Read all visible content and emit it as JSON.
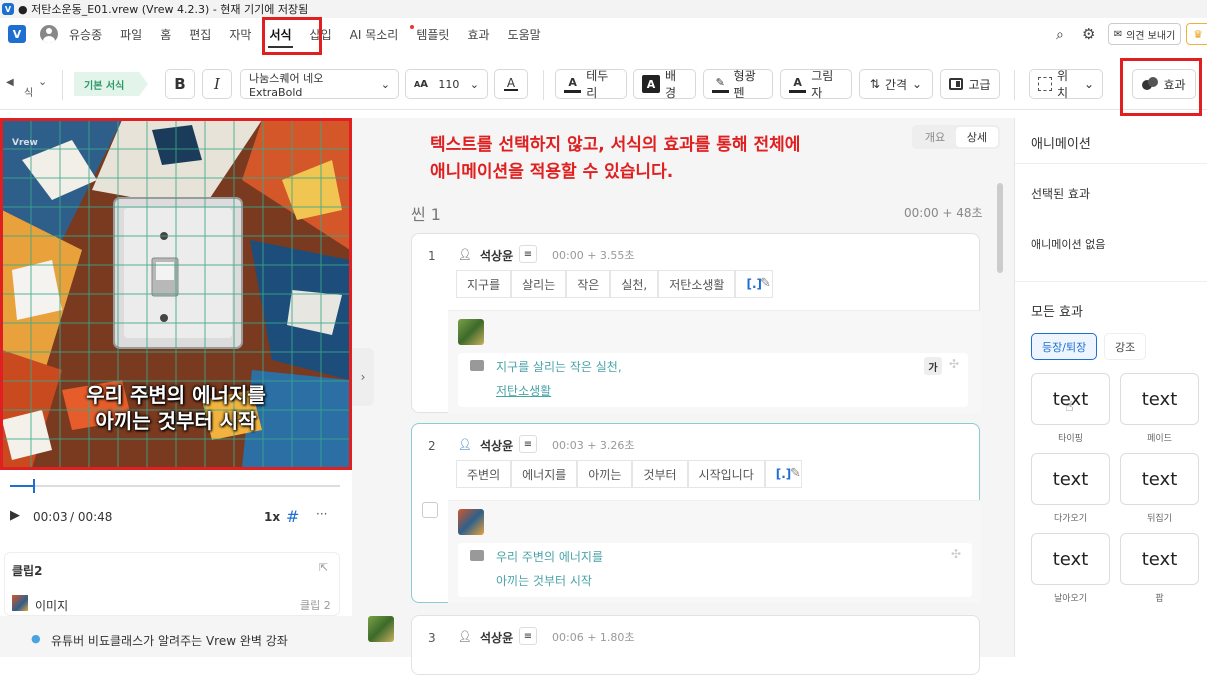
{
  "window": {
    "title": "● 저탄소운동_E01.vrew (Vrew 4.2.3) - 현재 기기에 저장됨"
  },
  "menu": {
    "items": [
      "유승종",
      "파일",
      "홈",
      "편집",
      "자막",
      "서식",
      "삽입",
      "AI 목소리",
      "템플릿",
      "효과",
      "도움말"
    ],
    "feedback_label": "의견 보내기"
  },
  "toolbar": {
    "preset_label": "기본 서식",
    "bold": "B",
    "italic": "I",
    "font_family": "나눔스퀘어 네오 ExtraBold",
    "font_size_icon": "A",
    "font_size": "110",
    "font_color_icon": "A",
    "border_label": "테두리",
    "background_label": "배경",
    "highlighter_label": "형광펜",
    "shadow_label": "그림자",
    "spacing_label": "간격",
    "advanced_label": "고급",
    "position_label": "위치",
    "effect_label": "효과",
    "left_cut": "식"
  },
  "preview": {
    "watermark": "Vrew",
    "subtitle_line1": "우리 주변의 에너지를",
    "subtitle_line2": "아끼는 것부터 시작",
    "time_current": "00:03",
    "time_total": "/ 00:48",
    "speed": "1x",
    "progress": 0.07
  },
  "clip_panel": {
    "title": "클립2",
    "item_label": "이미지",
    "item_meta": "클립 2",
    "promo": "유튜버 비됴클래스가 알려주는 Vrew 완벽 강좌"
  },
  "center": {
    "annotation_line1": "텍스트를 선택하지 않고, 서식의 효과를 통해 전체에",
    "annotation_line2": "애니메이션을 적용할 수 있습니다.",
    "view_toggle": [
      "개요",
      "상세"
    ],
    "scene_title": "씬 1",
    "scene_time": "00:00 + 48초",
    "clips": [
      {
        "num": "1",
        "speaker": "석상윤",
        "time": "00:00 + 3.55초",
        "words": [
          "지구를",
          "살리는",
          "작은",
          "실천,",
          "저탄소생활",
          "[.]"
        ],
        "subtitle_line1": "지구를 살리는 작은 실천,",
        "subtitle_line2": "저탄소생활",
        "style_badge": "가"
      },
      {
        "num": "2",
        "speaker": "석상윤",
        "time": "00:03 + 3.26초",
        "words": [
          "주변의",
          "에너지를",
          "아끼는",
          "것부터",
          "시작입니다",
          "[.]"
        ],
        "subtitle_line1": "우리 주변의 에너지를",
        "subtitle_line2": "아끼는 것부터 시작"
      },
      {
        "num": "3",
        "speaker": "석상윤",
        "time": "00:06 + 1.80초"
      }
    ]
  },
  "right_panel": {
    "title": "애니메이션",
    "selected_heading": "선택된 효과",
    "selected_value": "애니메이션 없음",
    "all_heading": "모든 효과",
    "tabs": [
      "등장/퇴장",
      "강조"
    ],
    "effects": [
      {
        "sample": "text",
        "name": "타이핑"
      },
      {
        "sample": "text",
        "name": "페이드"
      },
      {
        "sample": "text",
        "name": "다가오기"
      },
      {
        "sample": "text",
        "name": "뒤집기"
      },
      {
        "sample": "text",
        "name": "날아오기"
      },
      {
        "sample": "text",
        "name": "팝"
      }
    ]
  },
  "colors": {
    "accent": "#1f6fd1",
    "annotation_red": "#e02020",
    "teal": "#4aa3a8",
    "preset_green": "#2e9a6a"
  }
}
